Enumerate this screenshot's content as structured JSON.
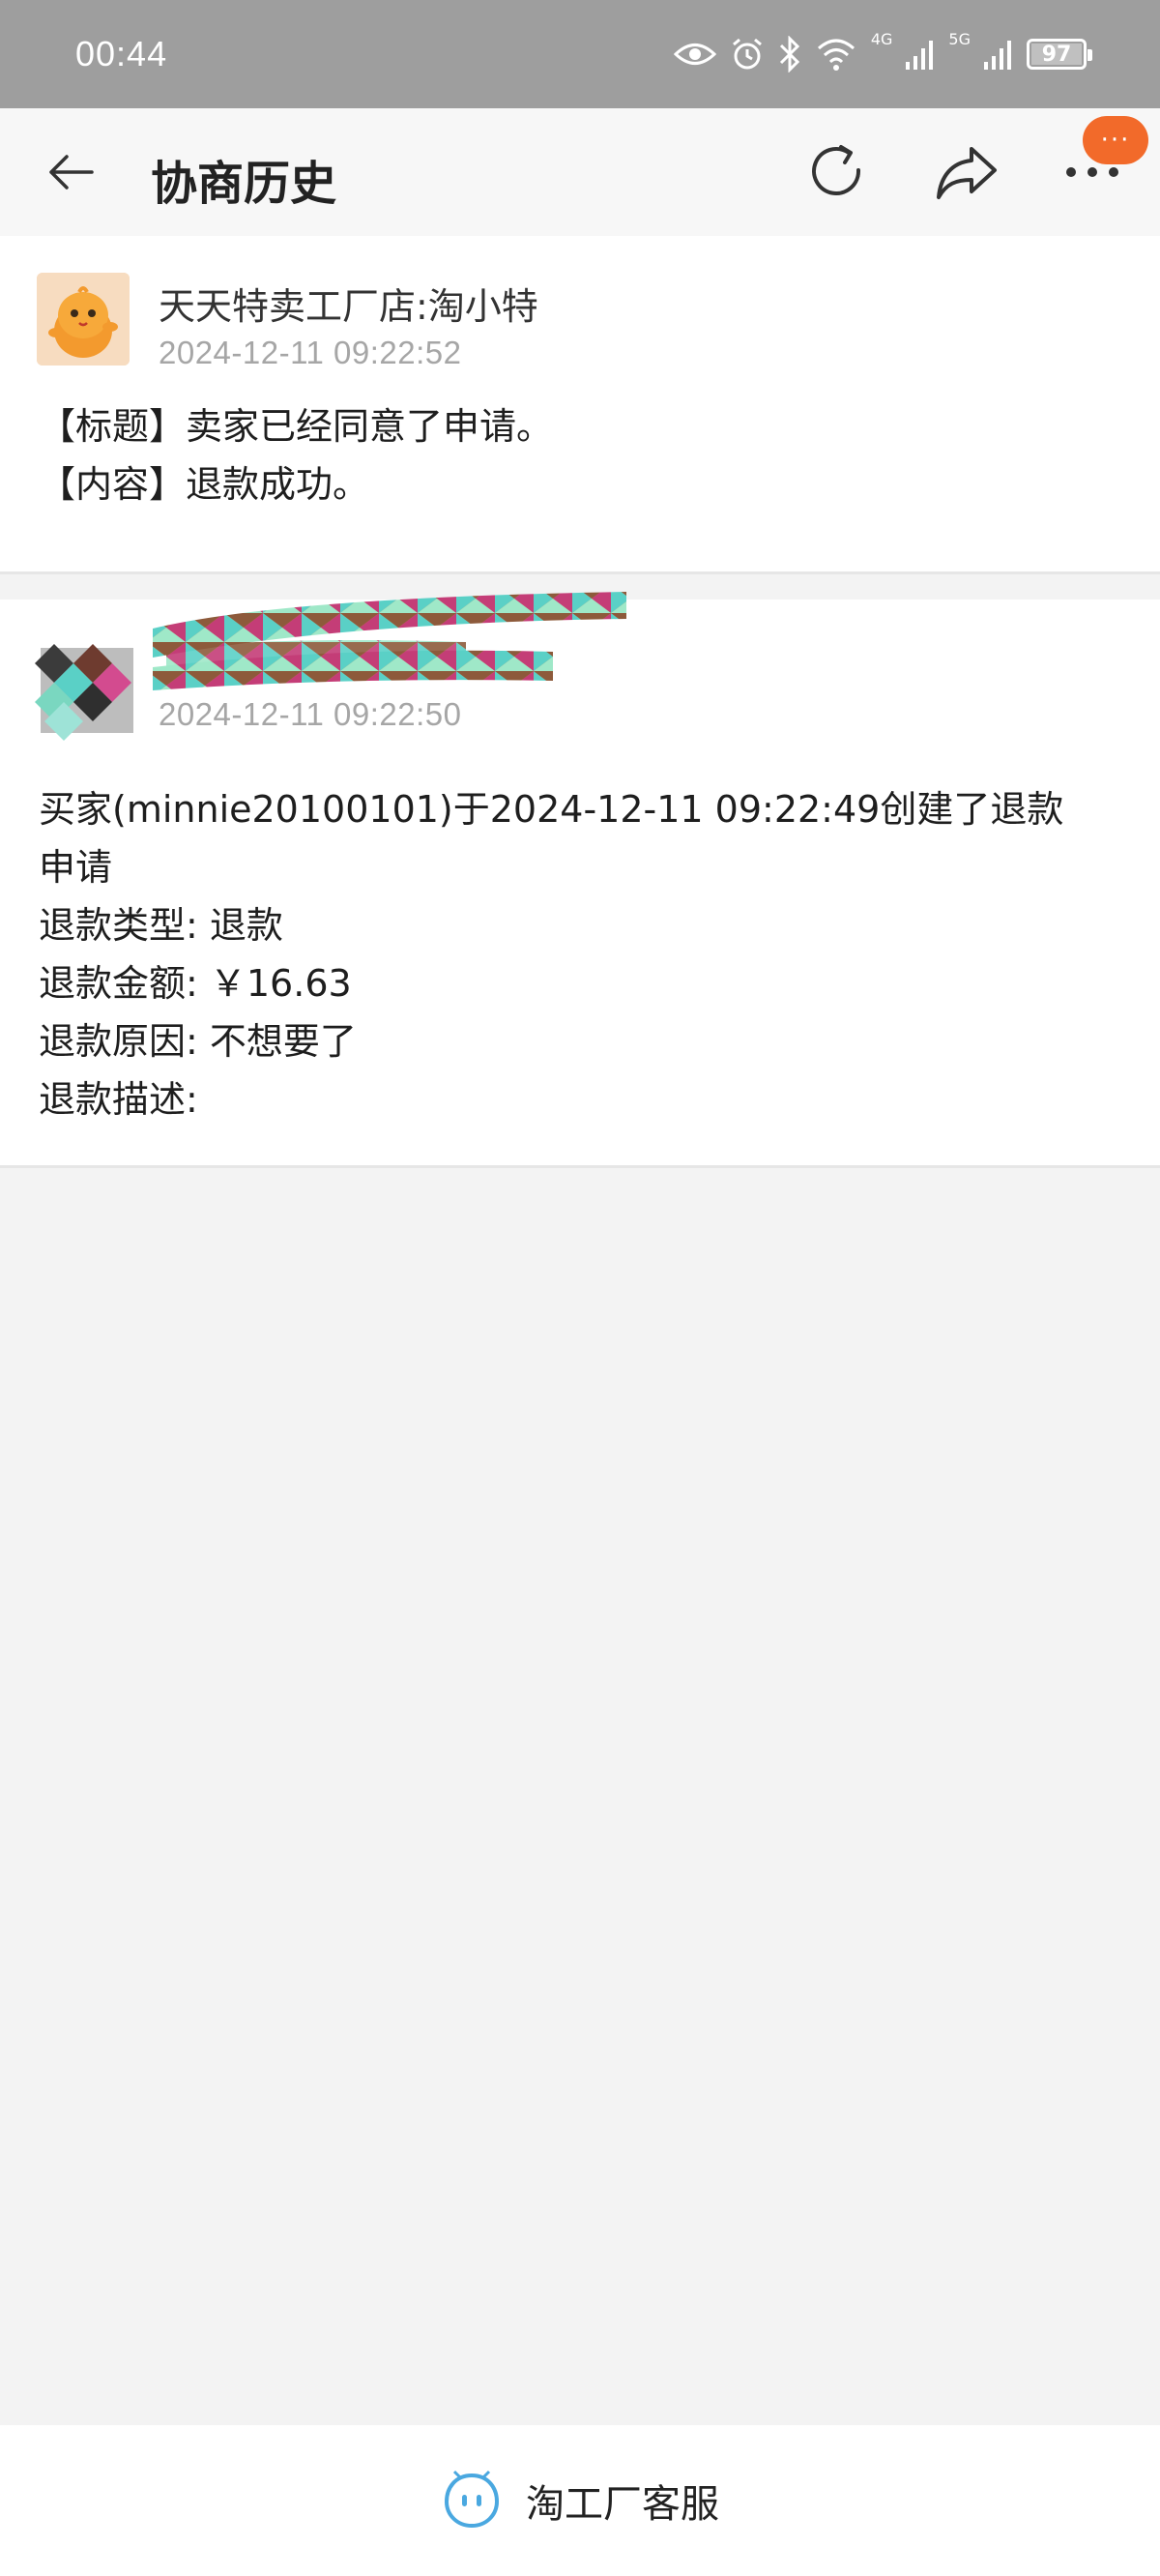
{
  "status_bar": {
    "time": "00:44",
    "battery": "97",
    "network_1": "4G",
    "network_2": "5G"
  },
  "header": {
    "title": "协商历史",
    "badge": "···"
  },
  "messages": [
    {
      "sender": "天天特卖工厂店:淘小特",
      "time": "2024-12-11 09:22:52",
      "lines": [
        "【标题】卖家已经同意了申请。",
        "【内容】退款成功。"
      ]
    },
    {
      "sender": "",
      "time": "2024-12-11 09:22:50",
      "lines": [
        "买家(minnie20100101)于2024-12-11 09:22:49创建了退款",
        "申请",
        "退款类型: 退款",
        "退款金额: ￥16.63",
        "退款原因: 不想要了",
        "退款描述:"
      ]
    }
  ],
  "footer": {
    "service_label": "淘工厂客服"
  },
  "colors": {
    "accent": "#f26a2a",
    "service_icon": "#4aa8e0",
    "background": "#f3f3f3"
  }
}
